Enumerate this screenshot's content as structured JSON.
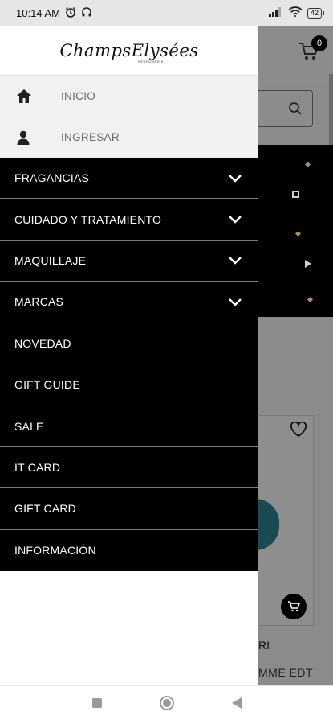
{
  "status_bar": {
    "time": "10:14 AM",
    "battery": "42"
  },
  "background": {
    "cart_count": "0",
    "product_name_fragment": "RI",
    "product_subtitle_fragment": "MME EDT"
  },
  "drawer": {
    "logo": "ChampsElysées",
    "logo_sub": "PERFUMERIE",
    "top_items": [
      {
        "label": "INICIO",
        "icon": "home-icon"
      },
      {
        "label": "INGRESAR",
        "icon": "user-icon"
      }
    ],
    "menu_items": [
      {
        "label": "FRAGANCIAS",
        "expandable": true
      },
      {
        "label": "CUIDADO Y TRATAMIENTO",
        "expandable": true
      },
      {
        "label": "MAQUILLAJE",
        "expandable": true
      },
      {
        "label": "MARCAS",
        "expandable": true
      },
      {
        "label": "NOVEDAD",
        "expandable": false
      },
      {
        "label": "GIFT GUIDE",
        "expandable": false
      },
      {
        "label": "SALE",
        "expandable": false
      },
      {
        "label": "IT CARD",
        "expandable": false
      },
      {
        "label": "GIFT CARD",
        "expandable": false
      },
      {
        "label": "INFORMACIÓN",
        "expandable": false
      }
    ]
  },
  "colors": {
    "menu_bg": "#000000",
    "accent_dot": "#a98b6a",
    "overlay": "#8b8b8b"
  }
}
